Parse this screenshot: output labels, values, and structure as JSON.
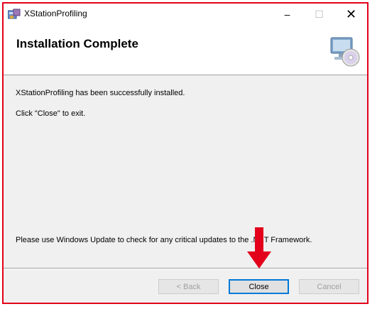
{
  "window": {
    "title": "XStationProfiling",
    "minimize_glyph": "–",
    "maximize_glyph": "☐",
    "close_glyph": "✕"
  },
  "header": {
    "title": "Installation Complete",
    "icon": "computer-cd-icon"
  },
  "content": {
    "message_installed": "XStationProfiling has been successfully installed.",
    "message_exit": "Click \"Close\" to exit.",
    "message_updates": "Please use Windows Update to check for any critical updates to the .NET Framework."
  },
  "buttons": {
    "back": "< Back",
    "close": "Close",
    "cancel": "Cancel"
  },
  "colors": {
    "annotation_border": "#e3001b",
    "annotation_arrow": "#e3001b",
    "focus_blue": "#0078d7"
  }
}
